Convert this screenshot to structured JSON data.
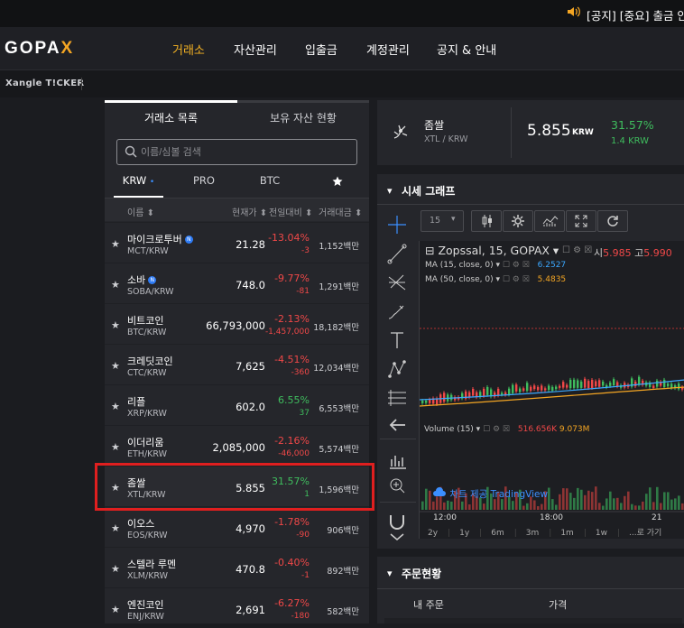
{
  "notice": {
    "text": "[공지] [중요] 출금 안"
  },
  "nav": {
    "logo_text": "GOPA",
    "logo_x": "X",
    "items": [
      "거래소",
      "자산관리",
      "입출금",
      "계정관리",
      "공지 & 안내"
    ]
  },
  "ticker": {
    "label": "Xangle T!CKER"
  },
  "market": {
    "tabs": [
      "거래소 목록",
      "보유 자산 현황"
    ],
    "search_placeholder": "이름/심볼 검색",
    "currency_tabs": [
      "KRW",
      "PRO",
      "BTC"
    ],
    "krw_dot": "•",
    "fav_tab_icon": "star-icon",
    "columns": {
      "name": "이름",
      "price": "현재가",
      "change": "전일대비",
      "volume": "거래대금"
    },
    "rows": [
      {
        "name": "마이크로투버",
        "symbol": "MCT/KRW",
        "badge": "N",
        "price": "21.28",
        "change": "-13.04%",
        "diff": "-3",
        "volume": "1,152백만",
        "dir": "down"
      },
      {
        "name": "소바",
        "symbol": "SOBA/KRW",
        "badge": "N",
        "price": "748.0",
        "change": "-9.77%",
        "diff": "-81",
        "volume": "1,291백만",
        "dir": "down"
      },
      {
        "name": "비트코인",
        "symbol": "BTC/KRW",
        "badge": "",
        "price": "66,793,000",
        "change": "-2.13%",
        "diff": "-1,457,000",
        "volume": "18,182백만",
        "dir": "down"
      },
      {
        "name": "크레딧코인",
        "symbol": "CTC/KRW",
        "badge": "",
        "price": "7,625",
        "change": "-4.51%",
        "diff": "-360",
        "volume": "12,034백만",
        "dir": "down"
      },
      {
        "name": "리플",
        "symbol": "XRP/KRW",
        "badge": "",
        "price": "602.0",
        "change": "6.55%",
        "diff": "37",
        "volume": "6,553백만",
        "dir": "up"
      },
      {
        "name": "이더리움",
        "symbol": "ETH/KRW",
        "badge": "",
        "price": "2,085,000",
        "change": "-2.16%",
        "diff": "-46,000",
        "volume": "5,574백만",
        "dir": "down"
      },
      {
        "name": "좀쌀",
        "symbol": "XTL/KRW",
        "badge": "",
        "price": "5.855",
        "change": "31.57%",
        "diff": "1",
        "volume": "1,596백만",
        "dir": "up"
      },
      {
        "name": "이오스",
        "symbol": "EOS/KRW",
        "badge": "",
        "price": "4,970",
        "change": "-1.78%",
        "diff": "-90",
        "volume": "906백만",
        "dir": "down"
      },
      {
        "name": "스텔라 루멘",
        "symbol": "XLM/KRW",
        "badge": "",
        "price": "470.8",
        "change": "-0.40%",
        "diff": "-1",
        "volume": "892백만",
        "dir": "down"
      },
      {
        "name": "엔진코인",
        "symbol": "ENJ/KRW",
        "badge": "",
        "price": "2,691",
        "change": "-6.27%",
        "diff": "-180",
        "volume": "582백만",
        "dir": "down"
      }
    ]
  },
  "coin": {
    "name": "좀쌀",
    "pair": "XTL / KRW",
    "price": "5.855",
    "unit": "KRW",
    "change": "31.57%",
    "diff": "1.4 KRW"
  },
  "chart": {
    "title": "시세 그래프",
    "interval": "15",
    "symbol_line": "Zopssal, 15, GOPAX",
    "open_label": "시",
    "open_value": "5.985",
    "high_label": "고",
    "high_value": "5.990",
    "ma1": "MA (15, close, 0)",
    "ma1_value": "6.2527",
    "ma2": "MA (50, close, 0)",
    "ma2_value": "5.4835",
    "volume_label": "Volume (15)",
    "vol1": "516.656K",
    "vol2": "9.073M",
    "watermark": "차트 제공 TradingView",
    "time_labels": [
      "12:00",
      "18:00",
      "21"
    ],
    "ranges": [
      "2y",
      "1y",
      "6m",
      "3m",
      "1m",
      "1w",
      "...로 가기"
    ]
  },
  "orders": {
    "title": "주문현황",
    "col1": "내 주문",
    "col2": "가격"
  }
}
